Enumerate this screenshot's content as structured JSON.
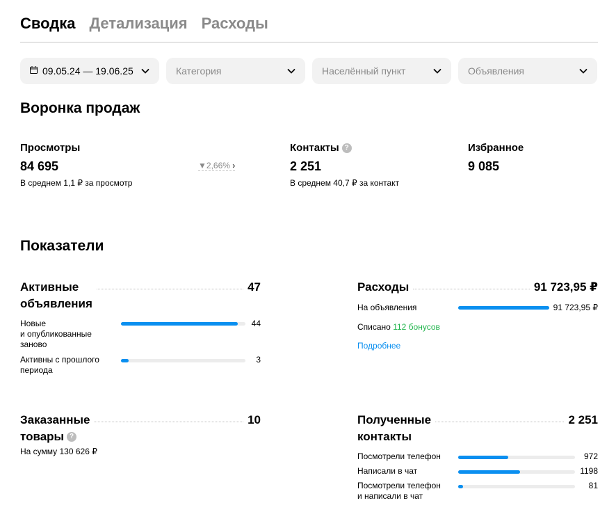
{
  "tabs": [
    {
      "label": "Сводка"
    },
    {
      "label": "Детализация"
    },
    {
      "label": "Расходы"
    }
  ],
  "filters": {
    "date": "09.05.24 — 19.06.25",
    "category_placeholder": "Категория",
    "city_placeholder": "Населённый пункт",
    "ads_placeholder": "Объявления"
  },
  "funnel": {
    "title": "Воронка продаж",
    "views": {
      "label": "Просмотры",
      "value": "84 695",
      "sub": "В среднем 1,1 ₽ за просмотр",
      "trend": "2,66%"
    },
    "contacts": {
      "label": "Контакты",
      "value": "2 251",
      "sub": "В среднем 40,7 ₽ за контакт"
    },
    "favorites": {
      "label": "Избранное",
      "value": "9 085"
    }
  },
  "indicators": {
    "title": "Показатели",
    "active_ads": {
      "title_line1": "Активные",
      "title_line2": "объявления",
      "total": "47",
      "rows": [
        {
          "label_line1": "Новые",
          "label_line2": "и опубликованные",
          "label_line3": "заново",
          "value": "44",
          "fraction": 0.94
        },
        {
          "label_line1": "Активны с прошлого",
          "label_line2": "периода",
          "value": "3",
          "fraction": 0.06
        }
      ]
    },
    "expenses": {
      "title": "Расходы",
      "total": "91 723,95 ₽",
      "row_label": "На объявления",
      "row_value": "91 723,95 ₽",
      "row_fraction": 1.0,
      "written_off_prefix": "Списано",
      "written_off_bonus": "112 бонусов",
      "more_link": "Подробнее"
    },
    "ordered": {
      "title_line1": "Заказанные",
      "title_line2": "товары",
      "total": "10",
      "sub": "На сумму 130 626 ₽"
    },
    "received_contacts": {
      "title_line1": "Полученные",
      "title_line2": "контакты",
      "total": "2 251",
      "rows": [
        {
          "label_line1": "Посмотрели телефон",
          "value": "972",
          "fraction": 0.43
        },
        {
          "label_line1": "Написали в чат",
          "value": "1198",
          "fraction": 0.53
        },
        {
          "label_line1": "Посмотрели телефон",
          "label_line2": "и написали в чат",
          "value": "81",
          "fraction": 0.036
        }
      ]
    }
  }
}
